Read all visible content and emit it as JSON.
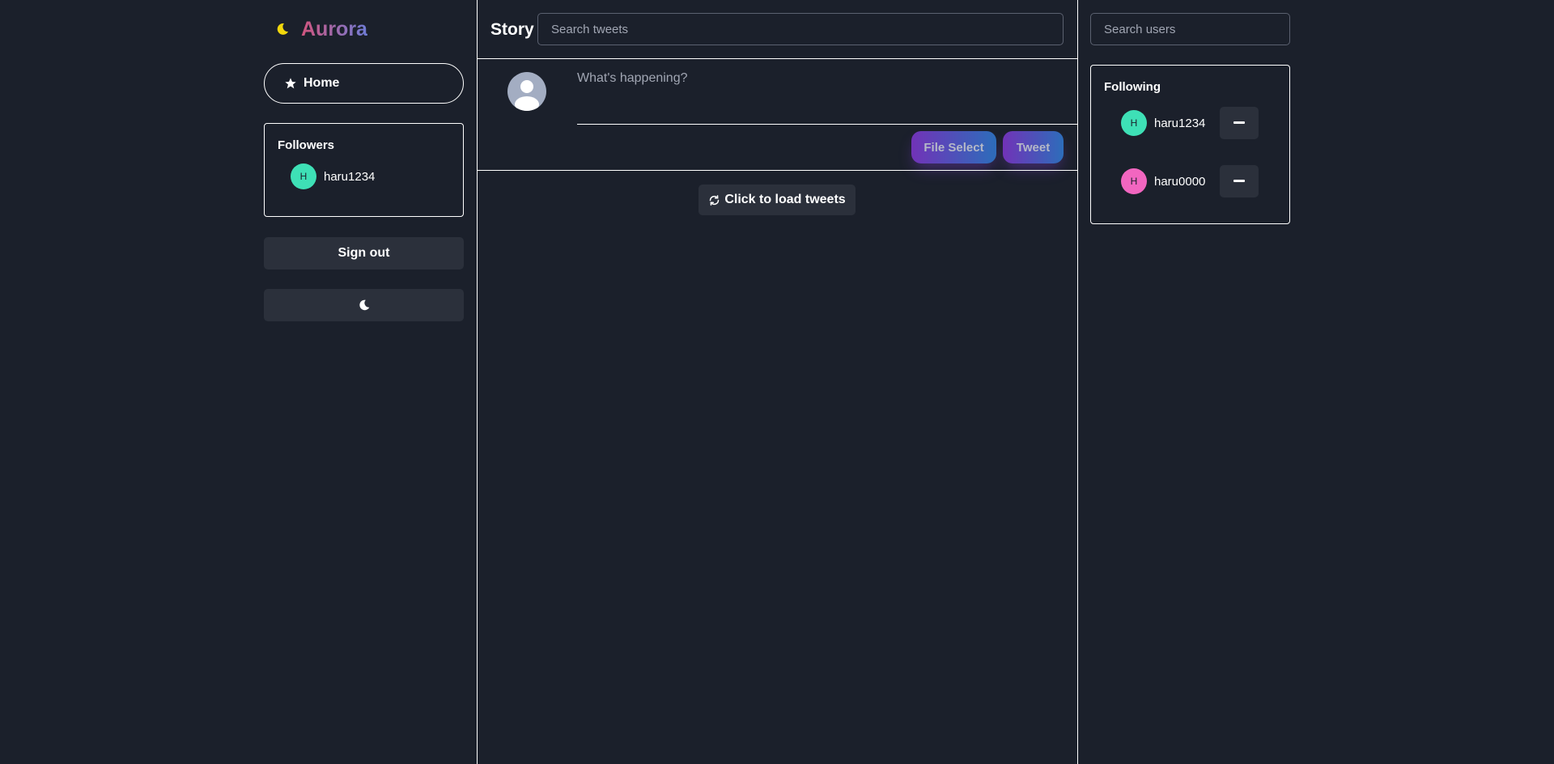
{
  "app": {
    "name": "Aurora"
  },
  "sidebar": {
    "home_label": "Home",
    "followers": {
      "title": "Followers",
      "users": [
        {
          "initial": "H",
          "username": "haru1234",
          "color": "#3ee0b6"
        }
      ]
    },
    "signout_label": "Sign out"
  },
  "main": {
    "title": "Story",
    "search_placeholder": "Search tweets",
    "composer": {
      "placeholder": "What's happening?",
      "file_button": "File Select",
      "tweet_button": "Tweet"
    },
    "load_button": "Click to load tweets"
  },
  "right": {
    "search_placeholder": "Search users",
    "following": {
      "title": "Following",
      "users": [
        {
          "initial": "H",
          "username": "haru1234",
          "color": "#3ee0b6"
        },
        {
          "initial": "H",
          "username": "haru0000",
          "color": "#f266c0"
        }
      ]
    }
  },
  "colors": {
    "background": "#1b202b",
    "button_bg": "#2b303b",
    "logo_gradient_start": "#d2557e",
    "logo_gradient_end": "#6f7cd6",
    "moon_icon": "#f2d70c"
  },
  "icons": [
    "moon-icon",
    "star-icon",
    "refresh-icon",
    "minus-icon",
    "user-silhouette-icon"
  ]
}
